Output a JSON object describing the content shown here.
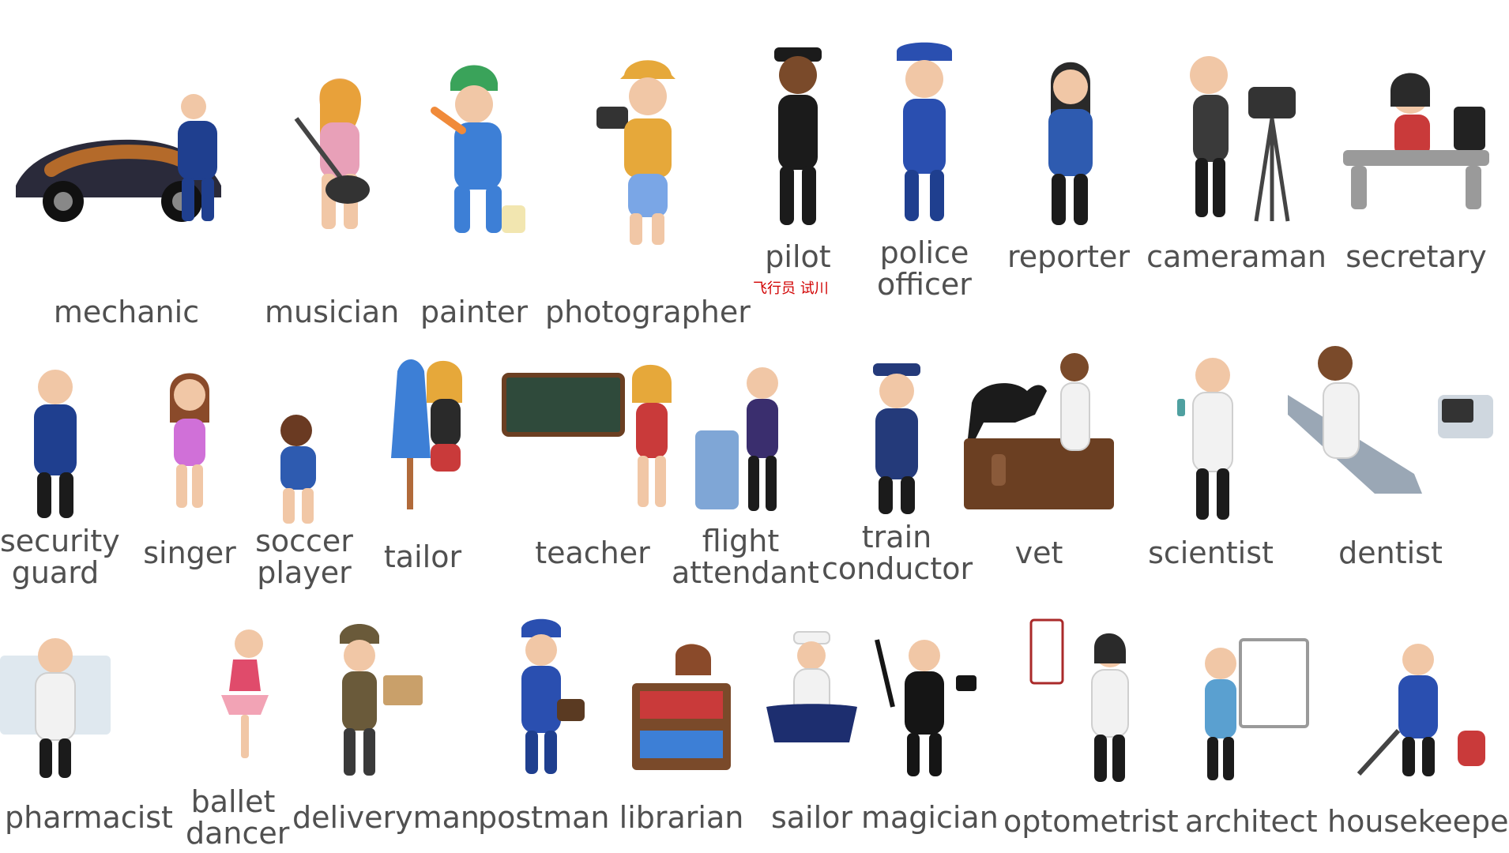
{
  "professions": [
    {
      "label": "mechanic",
      "icon": "mechanic-icon",
      "color": "#1f3f8f"
    },
    {
      "label": "musician",
      "icon": "musician-icon",
      "color": "#e8a0b8"
    },
    {
      "label": "painter",
      "icon": "painter-icon",
      "color": "#3d7fd6"
    },
    {
      "label": "photographer",
      "icon": "photographer-icon",
      "color": "#e6a83a"
    },
    {
      "label": "pilot",
      "icon": "pilot-icon",
      "color": "#1b1b1b"
    },
    {
      "label": "police\nofficer",
      "icon": "police-officer-icon",
      "color": "#2a4fb0"
    },
    {
      "label": "reporter",
      "icon": "reporter-icon",
      "color": "#2e5bb0"
    },
    {
      "label": "cameraman",
      "icon": "cameraman-icon",
      "color": "#3a3a3a"
    },
    {
      "label": "secretary",
      "icon": "secretary-icon",
      "color": "#c93a3a"
    },
    {
      "label": "security\nguard",
      "icon": "security-guard-icon",
      "color": "#1f3f8f"
    },
    {
      "label": "singer",
      "icon": "singer-icon",
      "color": "#d070d8"
    },
    {
      "label": "soccer\nplayer",
      "icon": "soccer-player-icon",
      "color": "#2e5bb0"
    },
    {
      "label": "tailor",
      "icon": "tailor-icon",
      "color": "#3d7fd6"
    },
    {
      "label": "teacher",
      "icon": "teacher-icon",
      "color": "#2f4a3b"
    },
    {
      "label": "flight\nattendant",
      "icon": "flight-attendant-icon",
      "color": "#3a2e6e"
    },
    {
      "label": "train\nconductor",
      "icon": "train-conductor-icon",
      "color": "#243a7a"
    },
    {
      "label": "vet",
      "icon": "vet-icon",
      "color": "#6b3f22"
    },
    {
      "label": "scientist",
      "icon": "scientist-icon",
      "color": "#4fa0a0"
    },
    {
      "label": "dentist",
      "icon": "dentist-icon",
      "color": "#9aa7b5"
    },
    {
      "label": "pharmacist",
      "icon": "pharmacist-icon",
      "color": "#9fb8c9"
    },
    {
      "label": "ballet\ndancer",
      "icon": "ballet-dancer-icon",
      "color": "#e04b6b"
    },
    {
      "label": "deliveryman",
      "icon": "deliveryman-icon",
      "color": "#6a5a3a"
    },
    {
      "label": "postman",
      "icon": "postman-icon",
      "color": "#2a4fb0"
    },
    {
      "label": "librarian",
      "icon": "librarian-icon",
      "color": "#7a4a2a"
    },
    {
      "label": "sailor",
      "icon": "sailor-icon",
      "color": "#1d2e6f"
    },
    {
      "label": "magician",
      "icon": "magician-icon",
      "color": "#151515"
    },
    {
      "label": "optometrist",
      "icon": "optometrist-icon",
      "color": "#aa2a2a"
    },
    {
      "label": "architect",
      "icon": "architect-icon",
      "color": "#5aa0d0"
    },
    {
      "label": "housekeeper",
      "icon": "housekeeper-icon",
      "color": "#2a4fb0"
    }
  ],
  "overlay_note": "飞行员 试川"
}
